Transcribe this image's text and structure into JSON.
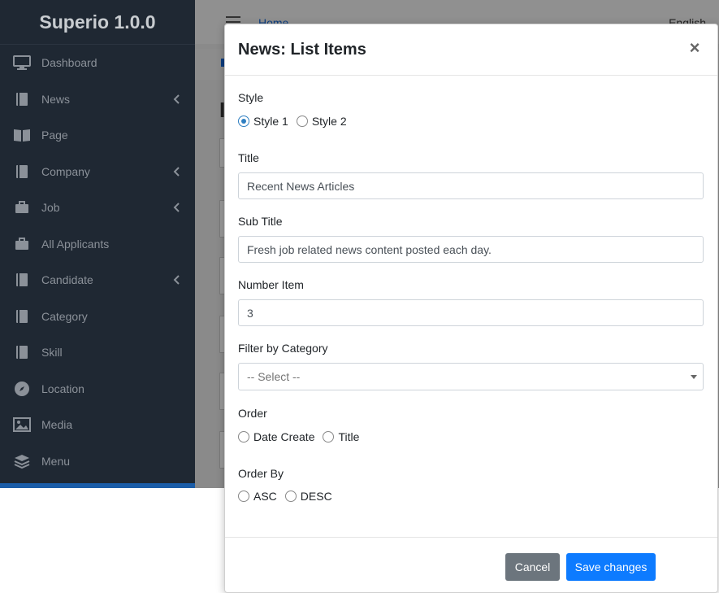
{
  "app": {
    "brand": "Superio 1.0.0",
    "home_link": "Home",
    "language": "English",
    "page_heading_char": "I"
  },
  "sidebar": {
    "items": [
      {
        "label": "Dashboard",
        "icon": "monitor-icon",
        "has_children": false
      },
      {
        "label": "News",
        "icon": "book-icon",
        "has_children": true
      },
      {
        "label": "Page",
        "icon": "open-book-icon",
        "has_children": false
      },
      {
        "label": "Company",
        "icon": "book-icon",
        "has_children": true
      },
      {
        "label": "Job",
        "icon": "briefcase-icon",
        "has_children": true
      },
      {
        "label": "All Applicants",
        "icon": "briefcase-icon",
        "has_children": false
      },
      {
        "label": "Candidate",
        "icon": "book-icon",
        "has_children": true
      },
      {
        "label": "Category",
        "icon": "book-icon",
        "has_children": false
      },
      {
        "label": "Skill",
        "icon": "book-icon",
        "has_children": false
      },
      {
        "label": "Location",
        "icon": "compass-icon",
        "has_children": false
      },
      {
        "label": "Media",
        "icon": "image-icon",
        "has_children": false
      },
      {
        "label": "Menu",
        "icon": "layers-icon",
        "has_children": false
      }
    ]
  },
  "modal": {
    "title": "News: List Items",
    "close_glyph": "×",
    "style": {
      "label": "Style",
      "options": [
        "Style 1",
        "Style 2"
      ],
      "selected": "Style 1"
    },
    "title_field": {
      "label": "Title",
      "value": "Recent News Articles"
    },
    "subtitle_field": {
      "label": "Sub Title",
      "value": "Fresh job related news content posted each day."
    },
    "number_item": {
      "label": "Number Item",
      "value": "3"
    },
    "filter_category": {
      "label": "Filter by Category",
      "selected": "-- Select --"
    },
    "order": {
      "label": "Order",
      "options": [
        "Date Create",
        "Title"
      ]
    },
    "order_by": {
      "label": "Order By",
      "options": [
        "ASC",
        "DESC"
      ]
    },
    "cancel_label": "Cancel",
    "save_label": "Save changes"
  },
  "colors": {
    "sidebar_bg": "#1f2833",
    "primary": "#0d7bff",
    "secondary": "#6c757d",
    "radio_checked": "#2f7fc1"
  }
}
